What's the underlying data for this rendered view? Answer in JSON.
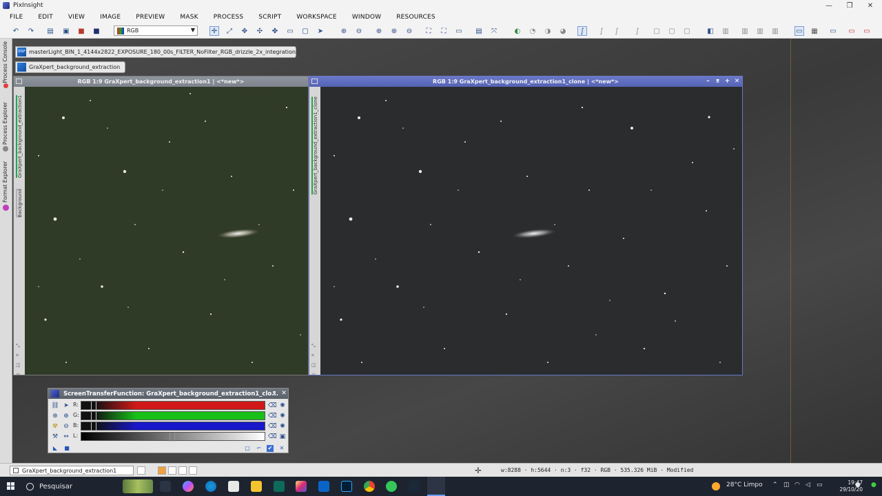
{
  "app": {
    "title": "PixInsight"
  },
  "menu": [
    "FILE",
    "EDIT",
    "VIEW",
    "IMAGE",
    "PREVIEW",
    "MASK",
    "PROCESS",
    "SCRIPT",
    "WORKSPACE",
    "WINDOW",
    "RESOURCES"
  ],
  "toolbar": {
    "color_space_value": "RGB"
  },
  "sidebar": {
    "tabs": [
      "Process Console",
      "Process Explorer",
      "Format Explorer"
    ]
  },
  "icons": [
    {
      "badge": "XISF",
      "label": "masterLight_BIN_1_4144x2822_EXPOSURE_180_00s_FILTER_NoFilter_RGB_drizzle_2x_integration"
    },
    {
      "badge": "",
      "label": "GraXpert_background_extraction"
    }
  ],
  "windows": {
    "left": {
      "title": "RGB 1:9 GraXpert_background_extraction1 | <*new*>",
      "id_label": "GraXpert_background_extraction1",
      "extra_tab": "Background"
    },
    "right": {
      "title": "RGB 1:9 GraXpert_background_extraction1_clone | <*new*>",
      "id_label": "GraXpert_background_extraction1_clone"
    }
  },
  "stf": {
    "title": "ScreenTransferFunction: GraXpert_background_extraction1_clo...",
    "channels": [
      {
        "label": "R:",
        "color": "#d01818",
        "shadow": 0.06,
        "midtone": 0.06
      },
      {
        "label": "G:",
        "color": "#18c018",
        "shadow": 0.06,
        "midtone": 0.06
      },
      {
        "label": "B:",
        "color": "#1818c8",
        "shadow": 0.06,
        "midtone": 0.06
      },
      {
        "label": "L:",
        "color": "#e0e0e0",
        "shadow": 0.0,
        "midtone": 0.5
      }
    ]
  },
  "status": {
    "view": "GraXpert_background_extraction1",
    "info": "w:8288 · h:5644 · n:3 · f32 · RGB · 535.326 MiB · Modified"
  },
  "taskbar": {
    "search": "Pesquisar",
    "weather": "28°C  Limpo",
    "time": "19:47",
    "date": "29/10/20"
  }
}
